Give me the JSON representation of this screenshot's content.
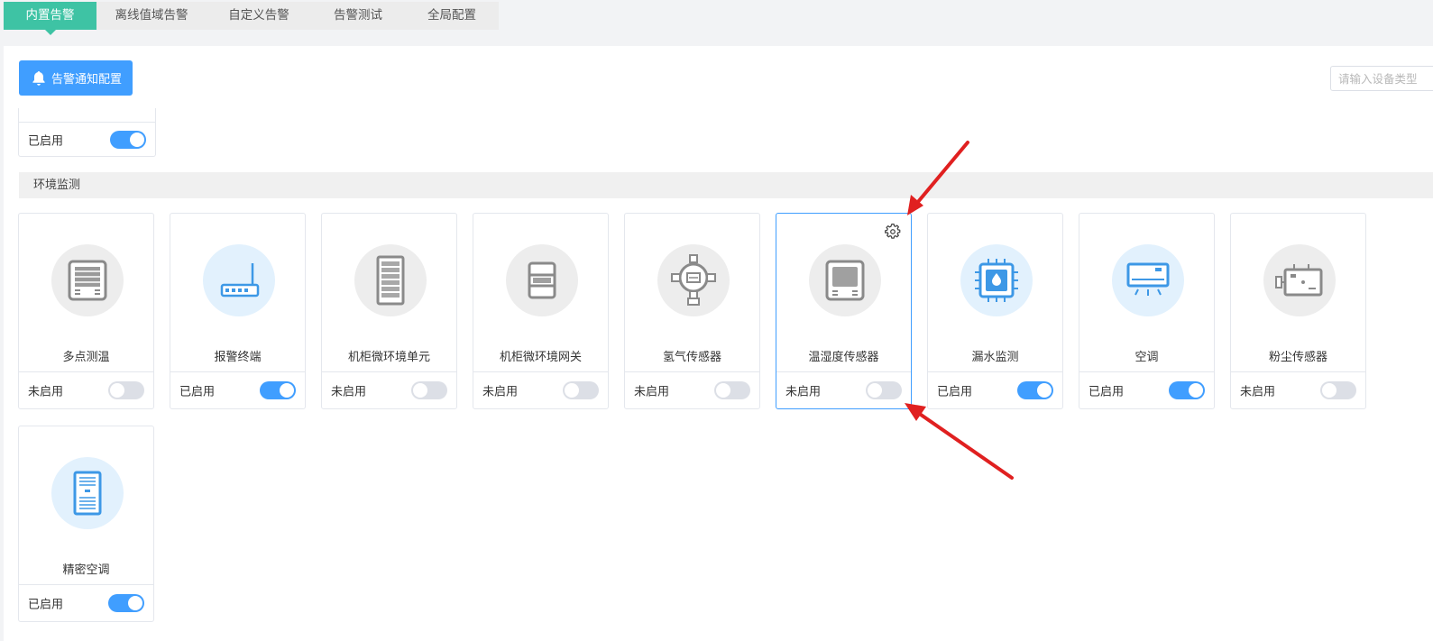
{
  "tabs": [
    "内置告警",
    "离线值域告警",
    "自定义告警",
    "告警测试",
    "全局配置"
  ],
  "toolbar": {
    "notify_label": "告警通知配置",
    "search_placeholder": "请输入设备类型"
  },
  "top_card": {
    "status": "已启用",
    "enabled": true
  },
  "section": {
    "title": "环境监测"
  },
  "devices": [
    {
      "name": "多点测温",
      "status": "未启用",
      "enabled": false,
      "icon": "multipoint-thermometer-icon",
      "circle": "gray"
    },
    {
      "name": "报警终端",
      "status": "已启用",
      "enabled": true,
      "icon": "router-icon",
      "circle": "blue"
    },
    {
      "name": "机柜微环境单元",
      "status": "未启用",
      "enabled": false,
      "icon": "cabinet-unit-icon",
      "circle": "gray"
    },
    {
      "name": "机柜微环境网关",
      "status": "未启用",
      "enabled": false,
      "icon": "cabinet-gateway-icon",
      "circle": "gray"
    },
    {
      "name": "氢气传感器",
      "status": "未启用",
      "enabled": false,
      "icon": "hydrogen-sensor-icon",
      "circle": "gray"
    },
    {
      "name": "温湿度传感器",
      "status": "未启用",
      "enabled": false,
      "icon": "temperature-humidity-sensor-icon",
      "circle": "gray",
      "selected": true
    },
    {
      "name": "漏水监测",
      "status": "已启用",
      "enabled": true,
      "icon": "water-leak-icon",
      "circle": "blue"
    },
    {
      "name": "空调",
      "status": "已启用",
      "enabled": true,
      "icon": "air-conditioner-icon",
      "circle": "blue"
    },
    {
      "name": "粉尘传感器",
      "status": "未启用",
      "enabled": false,
      "icon": "dust-sensor-icon",
      "circle": "gray"
    },
    {
      "name": "精密空调",
      "status": "已启用",
      "enabled": true,
      "icon": "precision-air-conditioner-icon",
      "circle": "blue"
    }
  ],
  "colors": {
    "tab_active": "#3ec3a4",
    "primary": "#409eff",
    "annotation_arrow": "#e02020"
  }
}
